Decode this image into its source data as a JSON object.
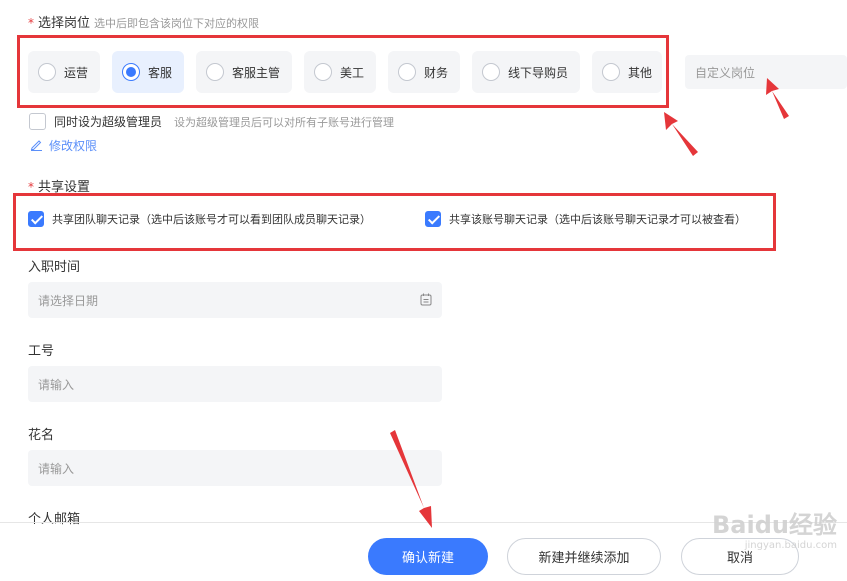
{
  "position": {
    "required_mark": "*",
    "title": "选择岗位",
    "hint": "选中后即包含该岗位下对应的权限",
    "options": [
      "运营",
      "客服",
      "客服主管",
      "美工",
      "财务",
      "线下导购员",
      "其他"
    ],
    "selected": "客服",
    "custom_placeholder": "自定义岗位"
  },
  "super_admin": {
    "label": "同时设为超级管理员",
    "hint": "设为超级管理员后可以对所有子账号进行管理",
    "checked": false
  },
  "edit_permission": {
    "label": "修改权限"
  },
  "share": {
    "required_mark": "*",
    "title": "共享设置",
    "option1": "共享团队聊天记录（选中后该账号才可以看到团队成员聊天记录）",
    "option2": "共享该账号聊天记录（选中后该账号聊天记录才可以被查看）",
    "option1_checked": true,
    "option2_checked": true
  },
  "fields": {
    "hire_date_label": "入职时间",
    "hire_date_placeholder": "请选择日期",
    "employee_id_label": "工号",
    "employee_id_placeholder": "请输入",
    "nickname_label": "花名",
    "nickname_placeholder": "请输入",
    "email_label": "个人邮箱"
  },
  "actions": {
    "confirm": "确认新建",
    "create_continue": "新建并继续添加",
    "cancel": "取消"
  },
  "watermark": {
    "brand": "Baidu经验",
    "url": "jingyan.baidu.com"
  },
  "colors": {
    "primary": "#3a7afe",
    "annotation_red": "#e5363a"
  }
}
